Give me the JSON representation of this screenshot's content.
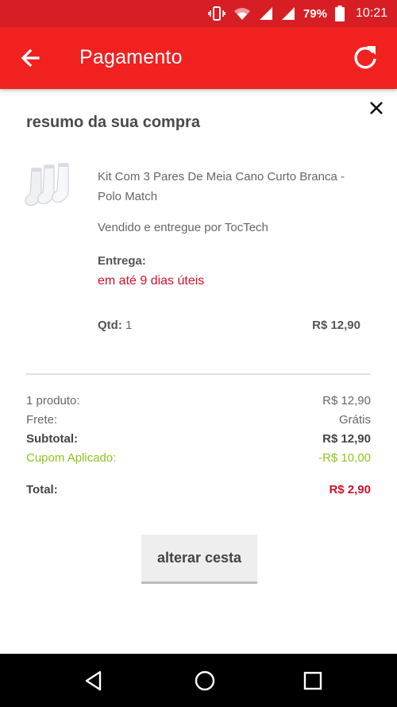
{
  "status_bar": {
    "battery": "79%",
    "time": "10:21",
    "icons": [
      "vibrate-icon",
      "wifi-icon",
      "signal-icon",
      "signal-icon",
      "battery-icon"
    ]
  },
  "app_bar": {
    "title": "Pagamento",
    "background_color": "#f0211f",
    "icons": [
      "arrow-back-icon",
      "refresh-icon"
    ]
  },
  "summary": {
    "title": "resumo da sua compra",
    "close_icon": "close-icon",
    "product": {
      "name": "Kit Com 3 Pares De Meia Cano Curto Branca - Polo Match",
      "seller": "Vendido e entregue por TocTech",
      "delivery_label": "Entrega:",
      "delivery_value": "em até 9 dias úteis",
      "qty_label": "Qtd:",
      "qty_value": "1",
      "price": "R$ 12,90"
    },
    "totals": {
      "products_label": "1 produto:",
      "products_value": "R$ 12,90",
      "shipping_label": "Frete:",
      "shipping_value": "Grátis",
      "subtotal_label": "Subtotal:",
      "subtotal_value": "R$ 12,90",
      "coupon_label": "Cupom Aplicado:",
      "coupon_value": "-R$ 10,00",
      "total_label": "Total:",
      "total_value": "R$ 2,90"
    },
    "alter_button": "alterar cesta",
    "colors": {
      "accent_red": "#d0112b",
      "coupon_green": "#8cc41e"
    }
  },
  "nav_bar": {
    "icons": [
      "back-triangle-icon",
      "home-circle-icon",
      "recents-square-icon"
    ]
  }
}
